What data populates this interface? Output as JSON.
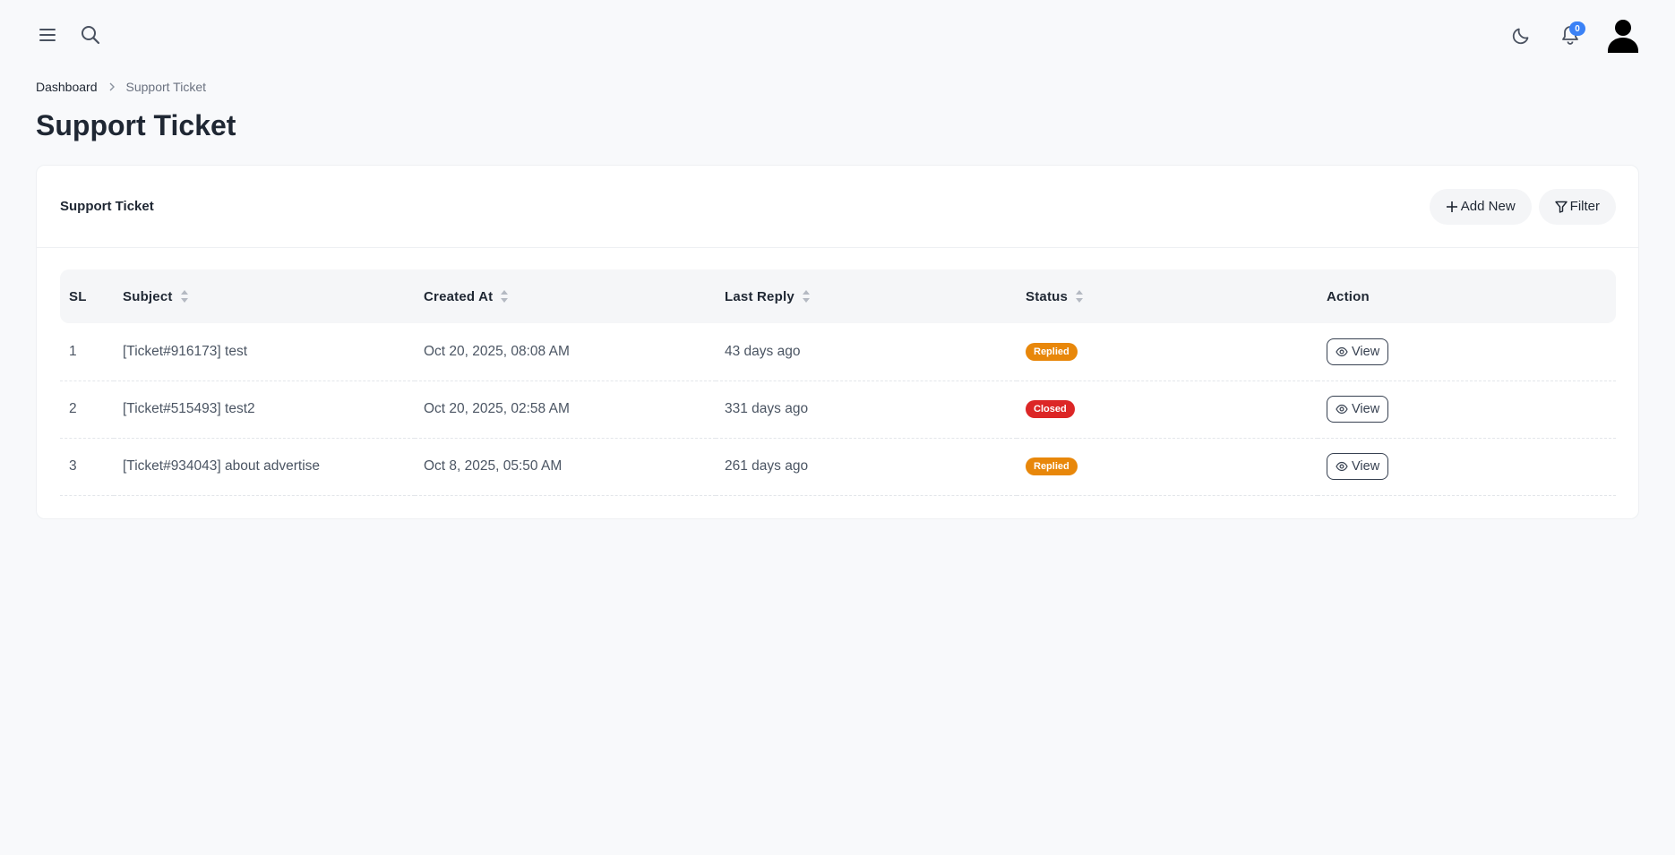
{
  "topbar": {
    "notification_count": "0"
  },
  "breadcrumb": {
    "home": "Dashboard",
    "current": "Support Ticket"
  },
  "page": {
    "title": "Support Ticket"
  },
  "card": {
    "title": "Support Ticket",
    "add_new_label": "Add New",
    "filter_label": "Filter"
  },
  "table": {
    "columns": [
      "SL",
      "Subject",
      "Created At",
      "Last Reply",
      "Status",
      "Action"
    ],
    "rows": [
      {
        "sl": "1",
        "subject": "[Ticket#916173] test",
        "created_at": "Oct 20, 2025, 08:08 AM",
        "last_reply": "43 days ago",
        "status": "Replied",
        "status_color": "#e8870a",
        "action": "View"
      },
      {
        "sl": "2",
        "subject": "[Ticket#515493] test2",
        "created_at": "Oct 20, 2025, 02:58 AM",
        "last_reply": "331 days ago",
        "status": "Closed",
        "status_color": "#dc2626",
        "action": "View"
      },
      {
        "sl": "3",
        "subject": "[Ticket#934043] about advertise",
        "created_at": "Oct 8, 2025, 05:50 AM",
        "last_reply": "261 days ago",
        "status": "Replied",
        "status_color": "#e8870a",
        "action": "View"
      }
    ]
  },
  "colors": {
    "badge_accent": "#3b82f6",
    "replied": "#e8870a",
    "closed": "#dc2626"
  },
  "icons": [
    "menu-icon",
    "search-icon",
    "moon-icon",
    "bell-icon",
    "user-avatar-icon",
    "chevron-right-icon",
    "plus-icon",
    "filter-icon",
    "sort-icon",
    "eye-icon"
  ]
}
